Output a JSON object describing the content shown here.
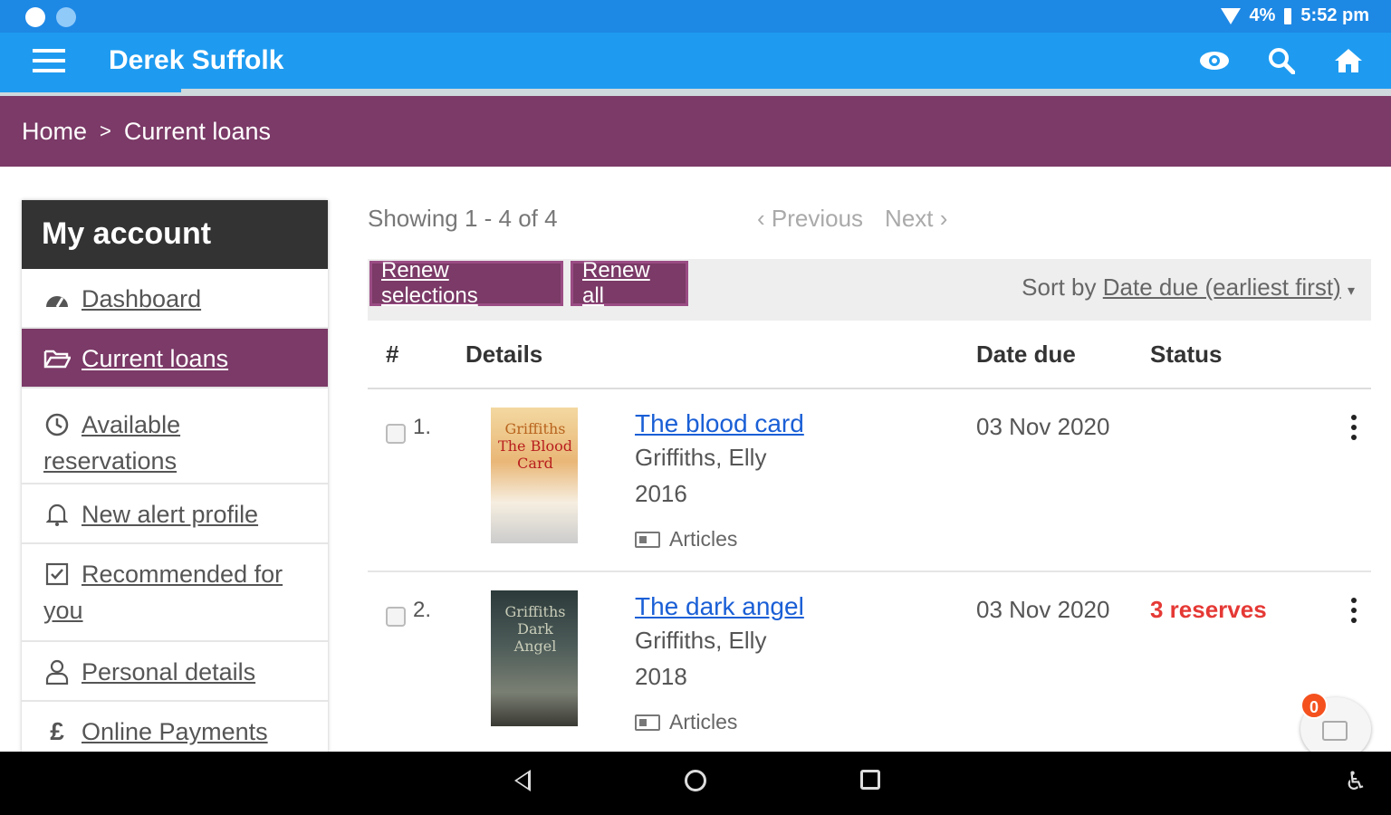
{
  "status_bar": {
    "battery": "4%",
    "time": "5:52 pm"
  },
  "app_bar": {
    "title": "Derek Suffolk"
  },
  "breadcrumb": {
    "home": "Home",
    "separator": ">",
    "current": "Current loans"
  },
  "sidebar": {
    "heading": "My account",
    "items": [
      {
        "label": "Dashboard",
        "icon": "dashboard-icon"
      },
      {
        "label": "Current loans",
        "icon": "folder-open-icon",
        "active": true
      },
      {
        "label": "Available reservations",
        "icon": "clock-icon"
      },
      {
        "label": "New alert profile",
        "icon": "bell-icon"
      },
      {
        "label": "Recommended for you",
        "icon": "checkbox-icon"
      },
      {
        "label": "Personal details",
        "icon": "user-icon"
      },
      {
        "label": "Online Payments",
        "icon": "pound-icon"
      }
    ]
  },
  "main": {
    "showing": "Showing 1 - 4 of 4",
    "previous": "Previous",
    "next": "Next",
    "renew_selections": "Renew selections",
    "renew_all": "Renew all",
    "sort_prefix": "Sort by",
    "sort_value": "Date due (earliest first)",
    "columns": {
      "num": "#",
      "details": "Details",
      "date_due": "Date due",
      "status": "Status"
    },
    "loans": [
      {
        "num": "1.",
        "title": "The blood card",
        "author": "Griffiths, Elly",
        "year": "2016",
        "type": "Articles",
        "date_due": "03 Nov 2020",
        "status": "",
        "cover_text": [
          "Griffiths",
          "The Blood",
          "Card"
        ]
      },
      {
        "num": "2.",
        "title": "The dark angel",
        "author": "Griffiths, Elly",
        "year": "2018",
        "type": "Articles",
        "date_due": "03 Nov 2020",
        "status": "3 reserves",
        "cover_text": [
          "Griffiths",
          "Dark",
          "Angel"
        ]
      }
    ]
  },
  "fab": {
    "badge": "0"
  },
  "colors": {
    "app_bar": "#1e9bf0",
    "status_bar": "#1e88e5",
    "brand": "#7b3a67",
    "link": "#1a5fd6",
    "alert": "#e53935"
  }
}
